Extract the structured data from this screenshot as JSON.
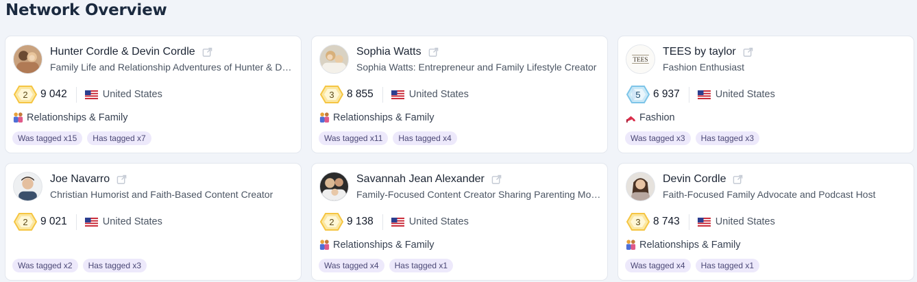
{
  "header": {
    "title": "Network Overview"
  },
  "cards": [
    {
      "name": "Hunter Cordle & Devin Cordle",
      "description": "Family Life and Relationship Adventures of Hunter & Devin",
      "level": "2",
      "followers": "9 042",
      "country": "United States",
      "category": "Relationships & Family",
      "category_icon": "family-icon",
      "was_tagged": "Was tagged x15",
      "has_tagged": "Has tagged x7"
    },
    {
      "name": "Sophia Watts",
      "description": "Sophia Watts: Entrepreneur and Family Lifestyle Creator",
      "level": "3",
      "followers": "8 855",
      "country": "United States",
      "category": "Relationships & Family",
      "category_icon": "family-icon",
      "was_tagged": "Was tagged x11",
      "has_tagged": "Has tagged x4"
    },
    {
      "name": "TEES by taylor",
      "description": "Fashion Enthusiast",
      "level": "5",
      "followers": "6 937",
      "country": "United States",
      "category": "Fashion",
      "category_icon": "high-heel-icon",
      "avatar_text": "TEES",
      "was_tagged": "Was tagged x3",
      "has_tagged": "Has tagged x3"
    },
    {
      "name": "Joe Navarro",
      "description": "Christian Humorist and Faith-Based Content Creator",
      "level": "2",
      "followers": "9 021",
      "country": "United States",
      "category": "",
      "was_tagged": "Was tagged x2",
      "has_tagged": "Has tagged x3"
    },
    {
      "name": "Savannah Jean Alexander",
      "description": "Family-Focused Content Creator Sharing Parenting Moments",
      "level": "2",
      "followers": "9 138",
      "country": "United States",
      "category": "Relationships & Family",
      "category_icon": "family-icon",
      "was_tagged": "Was tagged x4",
      "has_tagged": "Has tagged x1"
    },
    {
      "name": "Devin Cordle",
      "description": "Faith-Focused Family Advocate and Podcast Host",
      "level": "3",
      "followers": "8 743",
      "country": "United States",
      "category": "Relationships & Family",
      "category_icon": "family-icon",
      "was_tagged": "Was tagged x4",
      "has_tagged": "Has tagged x1"
    }
  ],
  "colors": {
    "badge_gold": "#f5c542",
    "badge_blue": "#7cc4e8",
    "tag_bg": "#ede9fb",
    "tag_text": "#4a4775"
  }
}
